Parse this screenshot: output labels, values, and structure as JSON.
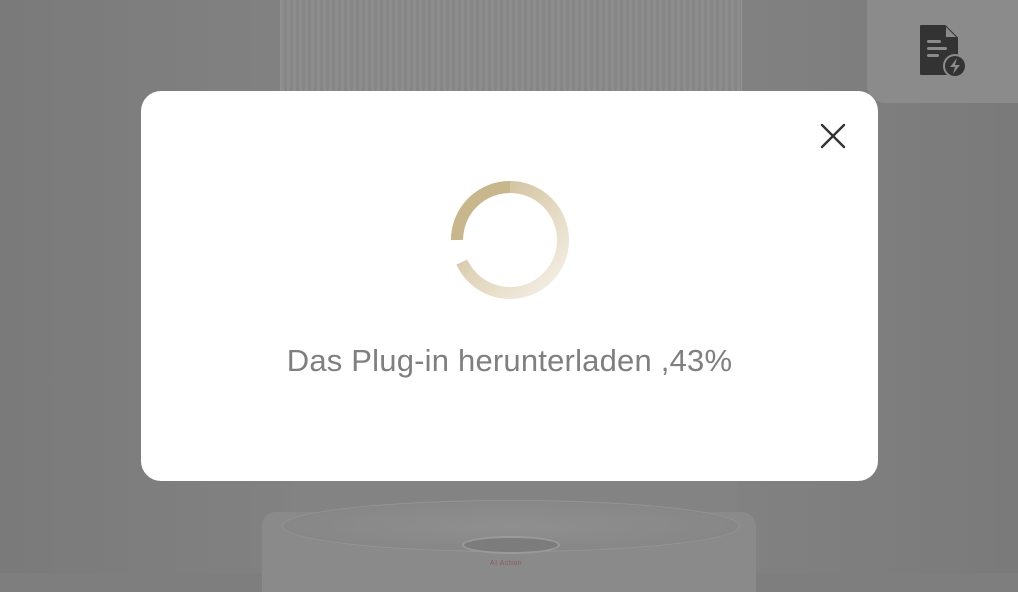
{
  "background": {
    "device_logo": "AI Action",
    "overlay_color": "#7e7e7e"
  },
  "log_button": {
    "icon": "document-lightning-icon",
    "icon_color": "#333333"
  },
  "dialog": {
    "close_icon": "close-icon",
    "spinner_icon": "loading-spinner-icon",
    "spinner_color": "#c8b68c",
    "message": "Das Plug-in herunterladen",
    "progress_separator": " ,",
    "progress_percent": "43%",
    "progress_value": 0.43
  }
}
